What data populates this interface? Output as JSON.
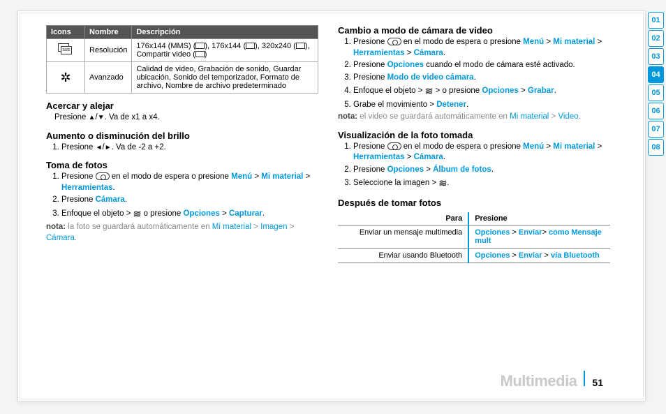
{
  "tabs": [
    "01",
    "02",
    "03",
    "04",
    "05",
    "06",
    "07",
    "08"
  ],
  "active_tab_index": 3,
  "footer": {
    "chapter_title": "Multimedia",
    "page_number": "51"
  },
  "icons_table": {
    "headers": [
      "Icons",
      "Nombre",
      "Descripción"
    ],
    "rows": [
      {
        "icon": "size",
        "nombre": "Resolución",
        "desc_parts": {
          "a": "176x144 (MMS) (",
          "b": "), 176x144 (",
          "c": "), 320x240 (",
          "d": "), Compartir video (",
          "e": ")"
        }
      },
      {
        "icon": "gear",
        "nombre": "Avanzado",
        "desc": "Calidad de video, Grabación de sonido, Guardar ubicación, Sonido del temporizador, Formato de archivo, Nombre de archivo predeterminado"
      }
    ]
  },
  "sections": {
    "zoom": {
      "title": "Acercar y alejar",
      "line_pre": "Presione ",
      "line_post": ". Va de x1 a x4."
    },
    "brightness": {
      "title": "Aumento o disminución del brillo",
      "step_pre": "Presione ",
      "step_post": ". Va de -2 a +2."
    },
    "takephoto": {
      "title": "Toma de fotos",
      "s1a": "Presione ",
      "s1b": " en el modo de espera o presione ",
      "menu": "Menú",
      "mimat": "Mi material",
      "herr": "Herramientas",
      "s2a": "Presione ",
      "camara": "Cámara",
      "s3a": "Enfoque el objeto > ",
      "s3b": " o presione ",
      "opc": "Opciones",
      "capt": "Capturar",
      "note_label": "nota:",
      "note_a": " la foto se guardará automáticamente en ",
      "note_mi": "Mi material",
      "note_img": "Imagen",
      "note_cam": "Cámara"
    },
    "videomode": {
      "title": "Cambio a modo de cámara de video",
      "s1a": "Presione ",
      "s1b": " en el modo de espera o presione ",
      "menu": "Menú",
      "mimat": "Mi material",
      "herr": "Herramientas",
      "cam": "Cámara",
      "s2a": "Presione ",
      "opc": "Opciones",
      "s2b": " cuando el modo de cámara esté activado.",
      "s3a": "Presione ",
      "mvid": "Modo de video cámara",
      "s4a": "Enfoque el objeto > ",
      "s4b": " > o presione ",
      "grab": "Grabar",
      "s5a": "Grabe el movimiento > ",
      "det": "Detener",
      "note_label": "nota:",
      "note_a": " el video se guardará automáticamente en ",
      "note_mi": "Mi material",
      "note_vid": "Video"
    },
    "viewphoto": {
      "title": "Visualización de la foto tomada",
      "s1a": "Presione ",
      "s1b": " en el modo de espera o presione ",
      "menu": "Menú",
      "mimat": "Mi material",
      "herr": "Herramientas",
      "cam": "Cámara",
      "s2a": "Presione ",
      "opc": "Opciones",
      "alb": "Álbum de fotos",
      "s3a": "Seleccione la imagen > "
    },
    "after": {
      "title": "Después de tomar fotos",
      "headers": {
        "para": "Para",
        "pres": "Presione"
      },
      "rows": [
        {
          "para": "Enviar un mensaje multimedia",
          "opc": "Opciones",
          "env": "Enviar",
          "rest": "como Mensaje mult"
        },
        {
          "para": "Enviar usando Bluetooth",
          "opc": "Opciones",
          "env": "Enviar",
          "rest": "vía Bluetooth"
        }
      ]
    }
  }
}
